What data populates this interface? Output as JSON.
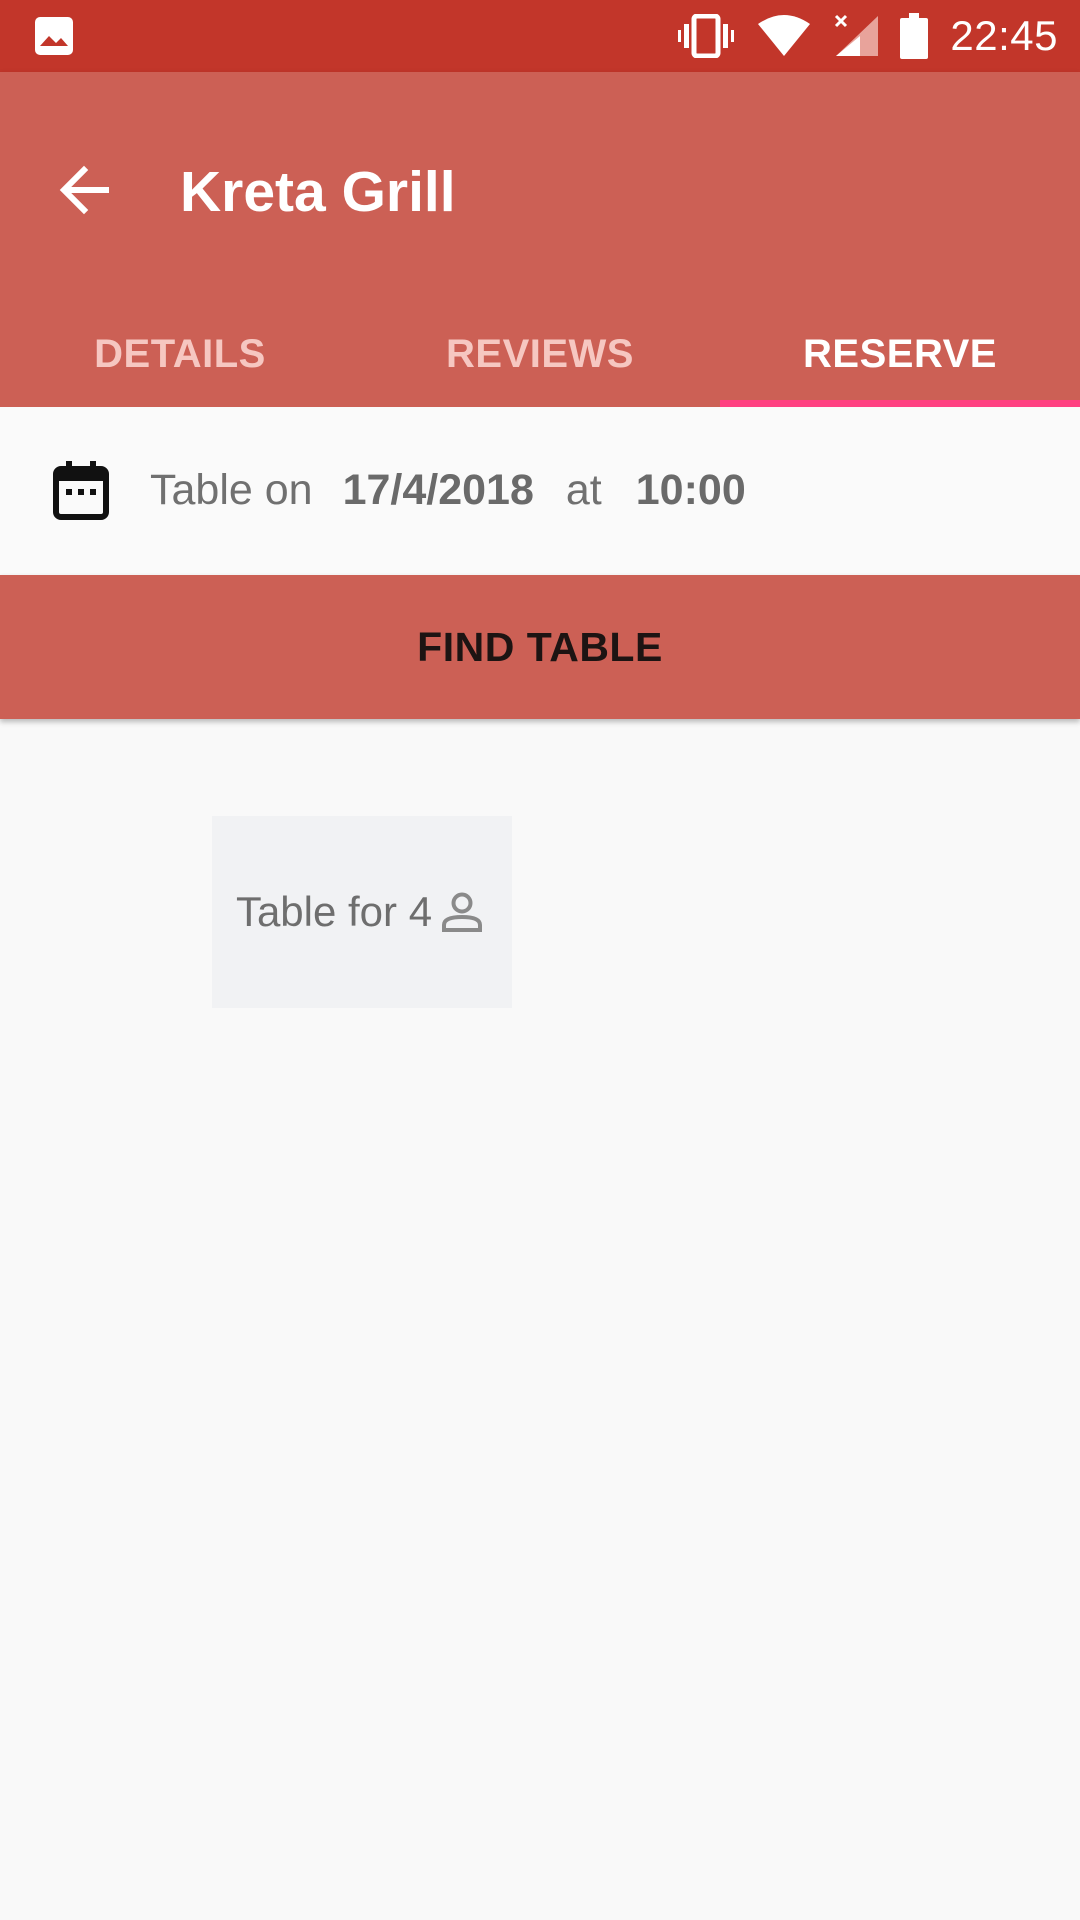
{
  "status_bar": {
    "left_icon": "image-icon",
    "icons": [
      "vibrate-icon",
      "wifi-icon",
      "signal-icon",
      "battery-icon"
    ],
    "time": "22:45"
  },
  "app_bar": {
    "back_icon": "arrow-back-icon",
    "title": "Kreta Grill",
    "tabs": [
      {
        "label": "DETAILS",
        "active": false
      },
      {
        "label": "REVIEWS",
        "active": false
      },
      {
        "label": "RESERVE",
        "active": true
      }
    ]
  },
  "reservation": {
    "calendar_icon": "calendar-icon",
    "prefix": "Table on",
    "date": "17/4/2018",
    "connector": "at",
    "time": "10:00"
  },
  "find_button": {
    "label": "FIND TABLE"
  },
  "tables": [
    {
      "label": "Table for 4",
      "icon": "person-icon"
    }
  ],
  "colors": {
    "status_bar": "#c2362a",
    "primary": "#cc6055",
    "tab_indicator": "#ff4081",
    "background": "#f9f9f9"
  }
}
